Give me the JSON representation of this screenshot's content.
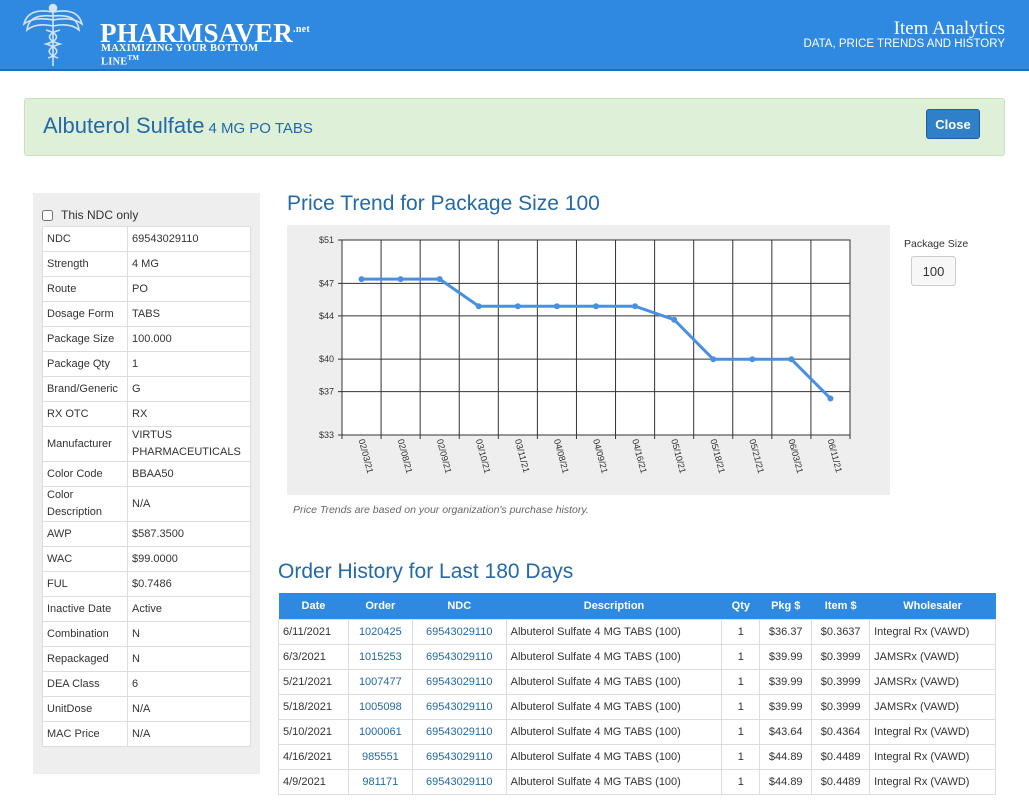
{
  "header": {
    "logo_brand": "PHARMSAVER",
    "logo_net": ".net",
    "logo_tagline": "MAXIMIZING YOUR BOTTOM LINE",
    "logo_tm": "TM",
    "title": "Item Analytics",
    "subtitle": "DATA, PRICE TRENDS AND HISTORY"
  },
  "product": {
    "name": "Albuterol Sulfate",
    "strength": "4 MG PO TABS",
    "close_label": "Close"
  },
  "details": {
    "ndc_only_label": "This NDC only",
    "rows": [
      {
        "label": "NDC",
        "value": "69543029110"
      },
      {
        "label": "Strength",
        "value": "4 MG"
      },
      {
        "label": "Route",
        "value": "PO"
      },
      {
        "label": "Dosage Form",
        "value": "TABS"
      },
      {
        "label": "Package Size",
        "value": "100.000"
      },
      {
        "label": "Package Qty",
        "value": "1"
      },
      {
        "label": "Brand/Generic",
        "value": "G"
      },
      {
        "label": "RX OTC",
        "value": "RX"
      },
      {
        "label": "Manufacturer",
        "value": "VIRTUS PHARMACEUTICALS"
      },
      {
        "label": "Color Code",
        "value": "BBAA50"
      },
      {
        "label": "Color Description",
        "value": "N/A"
      },
      {
        "label": "AWP",
        "value": "$587.3500"
      },
      {
        "label": "WAC",
        "value": "$99.0000"
      },
      {
        "label": "FUL",
        "value": "$0.7486"
      },
      {
        "label": "Inactive Date",
        "value": "Active"
      },
      {
        "label": "Combination",
        "value": "N"
      },
      {
        "label": "Repackaged",
        "value": "N"
      },
      {
        "label": "DEA Class",
        "value": "6"
      },
      {
        "label": "UnitDose",
        "value": "N/A"
      },
      {
        "label": "MAC Price",
        "value": "N/A"
      }
    ]
  },
  "price_trend": {
    "title": "Price Trend for Package Size 100",
    "note": "Price Trends are based on your organization's purchase history.",
    "package_size_label": "Package Size",
    "package_size_value": "100"
  },
  "chart_data": {
    "type": "line",
    "categories": [
      "02/03/21",
      "02/08/21",
      "02/09/21",
      "03/10/21",
      "03/11/21",
      "04/08/21",
      "04/09/21",
      "04/16/21",
      "05/10/21",
      "05/18/21",
      "05/21/21",
      "06/03/21",
      "06/11/21"
    ],
    "series": [
      {
        "values": [
          47.39,
          47.39,
          47.39,
          44.89,
          44.89,
          44.89,
          44.89,
          44.89,
          43.64,
          39.99,
          39.99,
          39.99,
          36.37
        ]
      }
    ],
    "y_ticks": [
      33,
      37,
      40,
      44,
      47,
      51
    ],
    "y_tick_labels": [
      "$33",
      "$37",
      "$40",
      "$44",
      "$47",
      "$51"
    ],
    "ylim": [
      33,
      51
    ],
    "grid": true,
    "line_color": "#4a90e2"
  },
  "order_history": {
    "title": "Order History for Last 180 Days",
    "columns": [
      "Date",
      "Order",
      "NDC",
      "Description",
      "Qty",
      "Pkg $",
      "Item $",
      "Wholesaler"
    ],
    "rows": [
      [
        "6/11/2021",
        "1020425",
        "69543029110",
        "Albuterol Sulfate 4 MG TABS (100)",
        "1",
        "$36.37",
        "$0.3637",
        "Integral Rx (VAWD)"
      ],
      [
        "6/3/2021",
        "1015253",
        "69543029110",
        "Albuterol Sulfate 4 MG TABS (100)",
        "1",
        "$39.99",
        "$0.3999",
        "JAMSRx (VAWD)"
      ],
      [
        "5/21/2021",
        "1007477",
        "69543029110",
        "Albuterol Sulfate 4 MG TABS (100)",
        "1",
        "$39.99",
        "$0.3999",
        "JAMSRx (VAWD)"
      ],
      [
        "5/18/2021",
        "1005098",
        "69543029110",
        "Albuterol Sulfate 4 MG TABS (100)",
        "1",
        "$39.99",
        "$0.3999",
        "JAMSRx (VAWD)"
      ],
      [
        "5/10/2021",
        "1000061",
        "69543029110",
        "Albuterol Sulfate 4 MG TABS (100)",
        "1",
        "$43.64",
        "$0.4364",
        "Integral Rx (VAWD)"
      ],
      [
        "4/16/2021",
        "985551",
        "69543029110",
        "Albuterol Sulfate 4 MG TABS (100)",
        "1",
        "$44.89",
        "$0.4489",
        "Integral Rx (VAWD)"
      ],
      [
        "4/9/2021",
        "981171",
        "69543029110",
        "Albuterol Sulfate 4 MG TABS (100)",
        "1",
        "$44.89",
        "$0.4489",
        "Integral Rx (VAWD)"
      ]
    ]
  },
  "colors": {
    "header_bg": "#2f89e0",
    "accent_text": "#2469a8",
    "success_bg": "#dff0d8"
  }
}
